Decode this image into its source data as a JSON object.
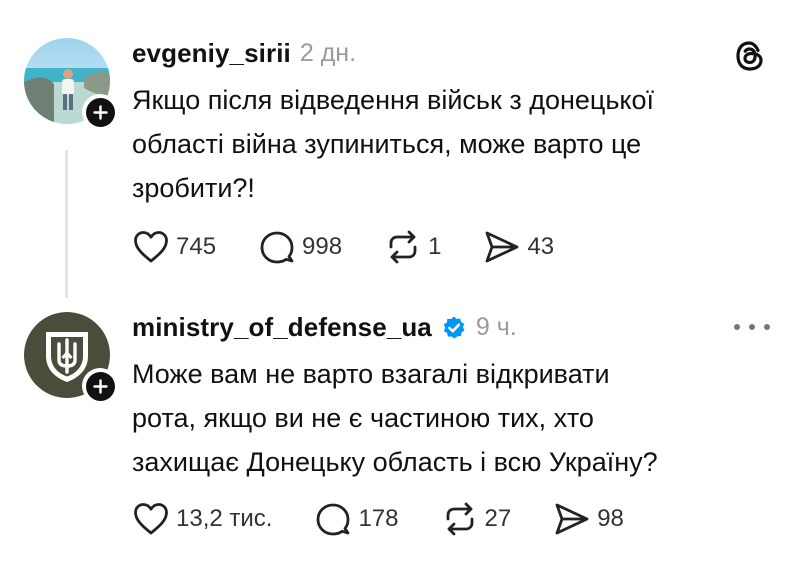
{
  "posts": [
    {
      "username": "evgeniy_sirii",
      "time": "2 дн.",
      "text": "Якщо після відведення військ з донецької\nобласті війна зупиниться, може варто це\nзробити?!",
      "likes": "745",
      "comments": "998",
      "reposts": "1",
      "shares": "43",
      "avatar_icon": "beach-photo-avatar",
      "header_icon": "threads-logo-icon"
    },
    {
      "username": "ministry_of_defense_ua",
      "verified": true,
      "verified_color": "#0095f6",
      "time": "9 ч.",
      "text": "Може вам не варто взагалі відкривати\nрота, якщо ви не є частиною тих, хто\nзахищає Донецьку область і всю Україну?",
      "likes": "13,2 тис.",
      "comments": "178",
      "reposts": "27",
      "shares": "98",
      "avatar_icon": "trident-emblem-avatar",
      "header_icon": "more-options-icon"
    }
  ],
  "colors": {
    "text": "#111111",
    "muted": "#9a9a9a",
    "thread_line": "#e3e3e3",
    "mod_avatar_bg": "#494d3a"
  }
}
